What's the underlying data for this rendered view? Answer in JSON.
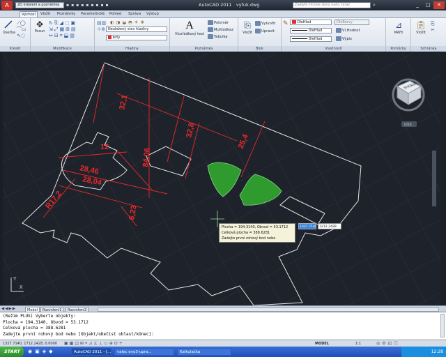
{
  "titlebar": {
    "workspace": "2D kreslení a poznámka",
    "app_title": "AutoCAD 2011",
    "filename": "vyfuk.dwg",
    "search_placeholder": "Zadejte klíčové slovo nebo výraz."
  },
  "ribbon_tabs": [
    "Výchozí",
    "Vložit",
    "Poznámky",
    "Parametrické",
    "Pohled",
    "Správa",
    "Výstup"
  ],
  "ribbon": {
    "panels": {
      "draw": "Kreslit",
      "modify": "Modifikace",
      "layers": "Hladiny",
      "annotation": "Poznámka",
      "block": "Blok",
      "properties": "Vlastnosti",
      "utilities": "Pomůcky",
      "clipboard": "Schránka"
    },
    "draw_tool": "Úsečka",
    "move_tool": "Posun",
    "layer_state": "Neuložený stav hladiny",
    "layer_current": "koty",
    "multiline_text": "Víceřádkový text",
    "annotation_items": [
      "Poloměr",
      "Multiodkaz",
      "Tabulka"
    ],
    "insert_block": "Vložit",
    "block_items": [
      "Vytvořit",
      "Upravit"
    ],
    "color": "DleHlad",
    "linetype": "DleHlad",
    "lineweight": "DleHlad",
    "plot_style": "DleBarvy",
    "list": "Výpis",
    "match": "Vl.Hodnot",
    "measure": "Měřit",
    "paste": "Vložit"
  },
  "viewcube": {
    "face": "SHORA",
    "label": "GSS"
  },
  "dimensions": [
    "32,1",
    "32,8",
    "25,4",
    "84,06",
    "12",
    "28,46",
    "28,04",
    "R17,2",
    "6,23"
  ],
  "tooltip": {
    "lines": [
      "Plocha = 194.3140, Obvod = 53.1712",
      "Celková plocha = 388.6281",
      "Zadejte první rohový bod nebo"
    ],
    "x_input": "1327.7140",
    "y_input": "1212.2428"
  },
  "layout_tabs": [
    "Model",
    "Rozvržení1",
    "Rozvržení2"
  ],
  "command_lines": [
    "(Režim PLUS) Vyberte objekty:",
    "Plocha = 194.3140, Obvod = 53.1712",
    "Celková plocha = 388.6281",
    "Zadejte první rohový bod nebo [Objekt/oDečíst oblast/kOnec]:"
  ],
  "status": {
    "coords": "1327.7140, 1712.2428, 0.0000",
    "mode": "MODEL",
    "scale": "1:1"
  },
  "taskbar": {
    "start": "START",
    "windows": [
      "AutoCAD 2011 - [...",
      "valec evo3-upra...",
      "Kalkulačka"
    ],
    "clock": "12:28"
  },
  "colors": {
    "dimension": "#e8292b",
    "hatch": "#2f9a2d",
    "geometry": "#e6e6e6",
    "background": "#1e232b"
  }
}
